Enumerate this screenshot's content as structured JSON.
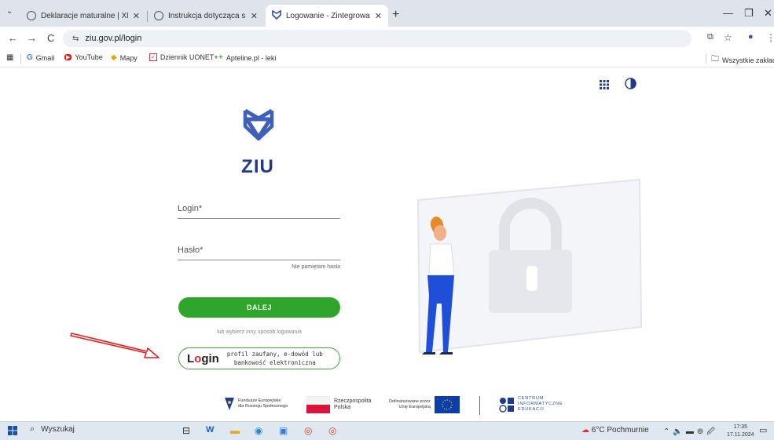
{
  "browser": {
    "tabs": [
      {
        "title": "Deklaracje maturalne | XI Liceu",
        "active": false
      },
      {
        "title": "Instrukcja dotycząca składania",
        "active": false
      },
      {
        "title": "Logowanie - Zintegrowany Inte",
        "active": true
      }
    ],
    "new_tab": "+",
    "window": {
      "minimize": "—",
      "restore": "❐",
      "close": "✕"
    },
    "nav": {
      "back": "←",
      "forward": "→",
      "reload": "C"
    },
    "url": "ziu.gov.pl/login",
    "bookmarks": [
      {
        "label": "Gmail",
        "icon": "G"
      },
      {
        "label": "YouTube",
        "icon": "▶"
      },
      {
        "label": "Mapy",
        "icon": "◆"
      },
      {
        "label": "Dziennik UONET+",
        "icon": "✓"
      },
      {
        "label": "Apteline.pl - leki",
        "icon": "+"
      }
    ],
    "all_bookmarks": "Wszystkie zakładk"
  },
  "page": {
    "logo_text": "ZIU",
    "login_label": "Login*",
    "password_label": "Hasło*",
    "forgot_password": "Nie pamiętam hasła",
    "next_button": "DALEJ",
    "alt_login_text": "lub wybierz inny sposób logowania",
    "login_gov": {
      "word_l": "L",
      "word_o": "o",
      "word_rest": "gin",
      "desc_line1": "profil zaufany, e-dowód lub",
      "desc_line2": "bankowość elektroniczna"
    },
    "footer": {
      "fe": {
        "line1": "Fundusze Europejskie",
        "line2": "dla Rozwoju Społecznego"
      },
      "pl": {
        "line1": "Rzeczpospolita",
        "line2": "Polska"
      },
      "eu": {
        "line1": "Dofinansowane przez",
        "line2": "Unię Europejską"
      },
      "cie": {
        "line1": "CENTRUM",
        "line2": "INFORMATYCZNE",
        "line3": "EDUKACJI"
      }
    }
  },
  "taskbar": {
    "search": "Wyszukaj",
    "weather": "6°C Pochmurnie",
    "time": "17:35",
    "date": "17.11.2024"
  },
  "colors": {
    "accent_green": "#2fa52c",
    "brand_blue": "#1e3a8a",
    "annotation_red": "#e02020"
  }
}
